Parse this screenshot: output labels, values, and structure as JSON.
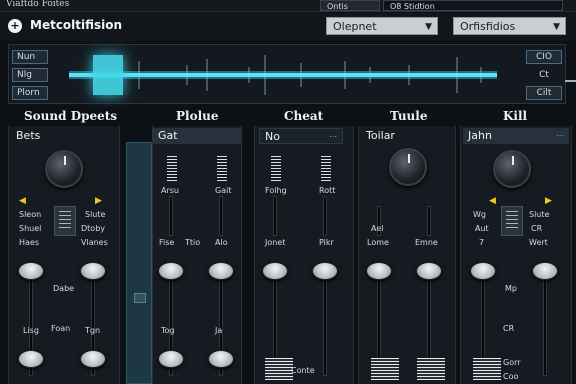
{
  "window": {
    "title": "Viaftdo Foites",
    "tab_1": "Ontis",
    "tab_2": "O8 Stidtion"
  },
  "header": {
    "app_name": "Metcoltifision",
    "dropdown_1": "Olepnet",
    "dropdown_2": "Orfisfidios"
  },
  "waveform": {
    "left_buttons": [
      "Nun",
      "Nlg",
      "Plorn"
    ],
    "right_buttons": [
      "CIO",
      "Ct",
      "Cilt"
    ]
  },
  "channels": [
    {
      "title": "Sound Dpeets",
      "header": "Bets",
      "labels": {
        "a": "Sleon",
        "b": "Slute",
        "c": "Shuel",
        "d": "Dtoby",
        "e": "Haes",
        "f": "Vlanes"
      },
      "mid": "Dabe",
      "bottom_a": "Lisg",
      "bottom_b": "Foan",
      "bottom_c": "Tgn"
    },
    {
      "title": "Plolue",
      "header": "Gat",
      "labels": {
        "a": "Arsu",
        "b": "Gait",
        "c": "Fise",
        "d": "Ttio",
        "e": "Alo"
      },
      "bottom_a": "Tog",
      "bottom_b": "Ja"
    },
    {
      "title": "Cheat",
      "header": "No",
      "labels": {
        "a": "Folhg",
        "b": "Rott",
        "c": "Jonet",
        "d": "Pikr"
      },
      "bottom_a": "Conte"
    },
    {
      "title": "Tuule",
      "header": "Toilar",
      "labels": {
        "a": "Ael",
        "b": "Lome",
        "c": "Emne"
      }
    },
    {
      "title": "Kill",
      "header": "Jahn",
      "labels": {
        "a": "Wg",
        "b": "Slute",
        "c": "Aut",
        "d": "CR",
        "e": "7",
        "f": "Wert"
      },
      "mid": "Mp",
      "bottom_a": "CR",
      "bottom_b": "Gorr",
      "bottom_c": "Coo"
    }
  ],
  "colors": {
    "accent": "#43d8ea",
    "yellow": "#f3c523",
    "panel": "#161b21"
  }
}
